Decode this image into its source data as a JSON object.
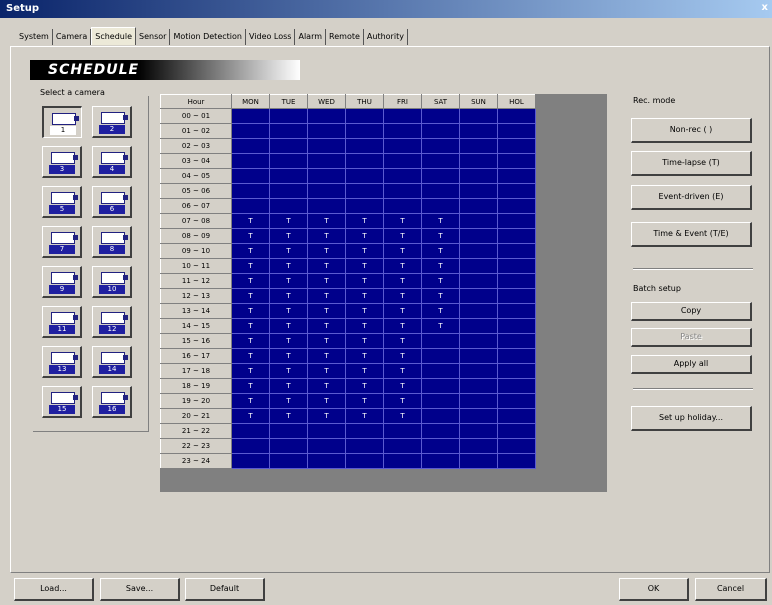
{
  "window": {
    "title": "Setup",
    "close": "x"
  },
  "tabs": [
    "System",
    "Camera",
    "Schedule",
    "Sensor",
    "Motion Detection",
    "Video Loss",
    "Alarm",
    "Remote",
    "Authority"
  ],
  "active_tab": 2,
  "banner": "SCHEDULE",
  "camera_select": {
    "label": "Select a camera",
    "cameras": [
      "1",
      "2",
      "3",
      "4",
      "5",
      "6",
      "7",
      "8",
      "9",
      "10",
      "11",
      "12",
      "13",
      "14",
      "15",
      "16"
    ],
    "selected": 0
  },
  "schedule": {
    "hour_header": "Hour",
    "days": [
      "MON",
      "TUE",
      "WED",
      "THU",
      "FRI",
      "SAT",
      "SUN",
      "HOL"
    ],
    "hours": [
      "00 ~ 01",
      "01 ~ 02",
      "02 ~ 03",
      "03 ~ 04",
      "04 ~ 05",
      "05 ~ 06",
      "06 ~ 07",
      "07 ~ 08",
      "08 ~ 09",
      "09 ~ 10",
      "10 ~ 11",
      "11 ~ 12",
      "12 ~ 13",
      "13 ~ 14",
      "14 ~ 15",
      "15 ~ 16",
      "16 ~ 17",
      "17 ~ 18",
      "18 ~ 19",
      "19 ~ 20",
      "20 ~ 21",
      "21 ~ 22",
      "22 ~ 23",
      "23 ~ 24"
    ],
    "cells": [
      [
        "",
        "",
        "",
        "",
        "",
        "",
        "",
        ""
      ],
      [
        "",
        "",
        "",
        "",
        "",
        "",
        "",
        ""
      ],
      [
        "",
        "",
        "",
        "",
        "",
        "",
        "",
        ""
      ],
      [
        "",
        "",
        "",
        "",
        "",
        "",
        "",
        ""
      ],
      [
        "",
        "",
        "",
        "",
        "",
        "",
        "",
        ""
      ],
      [
        "",
        "",
        "",
        "",
        "",
        "",
        "",
        ""
      ],
      [
        "",
        "",
        "",
        "",
        "",
        "",
        "",
        ""
      ],
      [
        "T",
        "T",
        "T",
        "T",
        "T",
        "T",
        "",
        ""
      ],
      [
        "T",
        "T",
        "T",
        "T",
        "T",
        "T",
        "",
        ""
      ],
      [
        "T",
        "T",
        "T",
        "T",
        "T",
        "T",
        "",
        ""
      ],
      [
        "T",
        "T",
        "T",
        "T",
        "T",
        "T",
        "",
        ""
      ],
      [
        "T",
        "T",
        "T",
        "T",
        "T",
        "T",
        "",
        ""
      ],
      [
        "T",
        "T",
        "T",
        "T",
        "T",
        "T",
        "",
        ""
      ],
      [
        "T",
        "T",
        "T",
        "T",
        "T",
        "T",
        "",
        ""
      ],
      [
        "T",
        "T",
        "T",
        "T",
        "T",
        "T",
        "",
        ""
      ],
      [
        "T",
        "T",
        "T",
        "T",
        "T",
        "",
        "",
        ""
      ],
      [
        "T",
        "T",
        "T",
        "T",
        "T",
        "",
        "",
        ""
      ],
      [
        "T",
        "T",
        "T",
        "T",
        "T",
        "",
        "",
        ""
      ],
      [
        "T",
        "T",
        "T",
        "T",
        "T",
        "",
        "",
        ""
      ],
      [
        "T",
        "T",
        "T",
        "T",
        "T",
        "",
        "",
        ""
      ],
      [
        "T",
        "T",
        "T",
        "T",
        "T",
        "",
        "",
        ""
      ],
      [
        "",
        "",
        "",
        "",
        "",
        "",
        "",
        ""
      ],
      [
        "",
        "",
        "",
        "",
        "",
        "",
        "",
        ""
      ],
      [
        "",
        "",
        "",
        "",
        "",
        "",
        "",
        ""
      ]
    ]
  },
  "rec_mode": {
    "label": "Rec. mode",
    "buttons": [
      "Non-rec ( )",
      "Time-lapse (T)",
      "Event-driven (E)",
      "Time & Event (T/E)"
    ]
  },
  "batch_setup": {
    "label": "Batch setup",
    "copy": "Copy",
    "paste": "Paste",
    "apply_all": "Apply all",
    "holiday": "Set up holiday..."
  },
  "footer": {
    "load": "Load...",
    "save": "Save...",
    "default": "Default",
    "ok": "OK",
    "cancel": "Cancel"
  }
}
